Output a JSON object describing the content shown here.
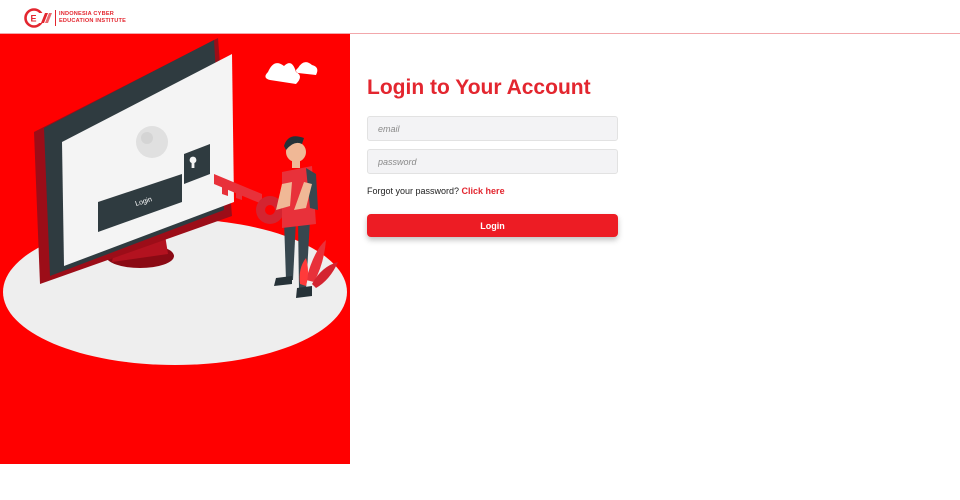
{
  "brand": {
    "line1": "INDONESIA CYBER",
    "line2": "EDUCATION INSTITUTE",
    "color": "#e3262f"
  },
  "hero": {
    "background": "#ff0000",
    "monitor_button_label": "Login"
  },
  "form": {
    "title": "Login to Your Account",
    "email_placeholder": "email",
    "password_placeholder": "password",
    "forgot_text": "Forgot your password?",
    "forgot_link": "Click here",
    "login_label": "Login"
  }
}
